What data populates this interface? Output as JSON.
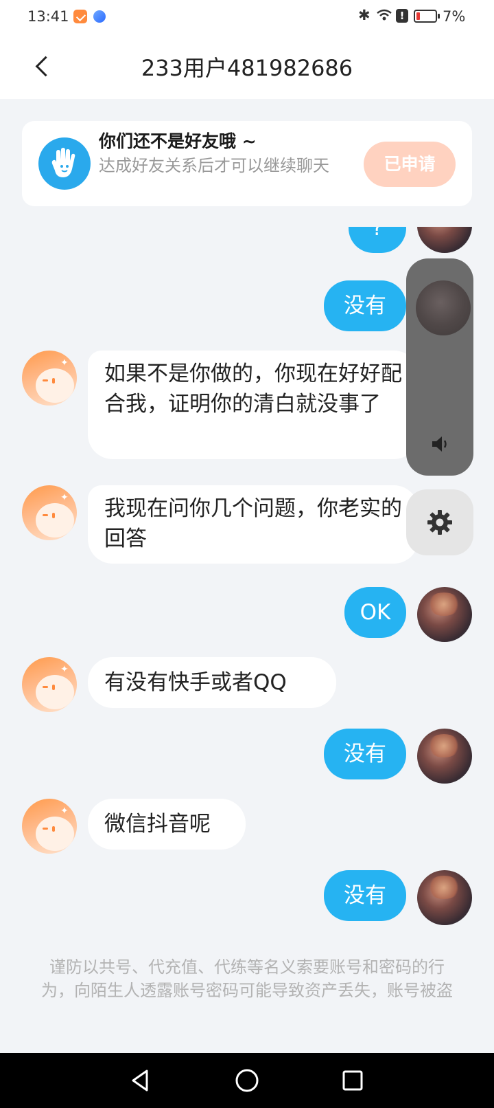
{
  "status_bar": {
    "time": "13:41",
    "battery_percent": "7%",
    "bluetooth_glyph": "✱",
    "alert_glyph": "!"
  },
  "header": {
    "title": "233用户481982686"
  },
  "friend_card": {
    "title": "你们还不是好友哦 ~",
    "subtitle": "达成好友关系后才可以继续聊天",
    "button_label": "已申请"
  },
  "messages": [
    {
      "from": "me",
      "text": "?"
    },
    {
      "from": "me",
      "text": "没有"
    },
    {
      "from": "them",
      "text": "如果不是你做的，你现在好好配合我，证明你的清白就没事了"
    },
    {
      "from": "them",
      "text": "我现在问你几个问题，你老实的回答"
    },
    {
      "from": "me",
      "text": "OK"
    },
    {
      "from": "them",
      "text": "有没有快手或者QQ"
    },
    {
      "from": "me",
      "text": "没有"
    },
    {
      "from": "them",
      "text": "微信抖音呢"
    },
    {
      "from": "me",
      "text": "没有"
    }
  ],
  "disclaimer": "谨防以共号、代充值、代练等名义索要账号和密码的行为，向陌生人透露账号密码可能导致资产丢失，账号被盗",
  "icons": {
    "back": "chevron-left-icon",
    "hand": "waving-hand-icon",
    "volume": "speaker-icon",
    "settings": "gear-icon"
  },
  "colors": {
    "accent_blue": "#26b3f2",
    "applied_button": "#ffd2c0",
    "background": "#f2f4f7"
  }
}
